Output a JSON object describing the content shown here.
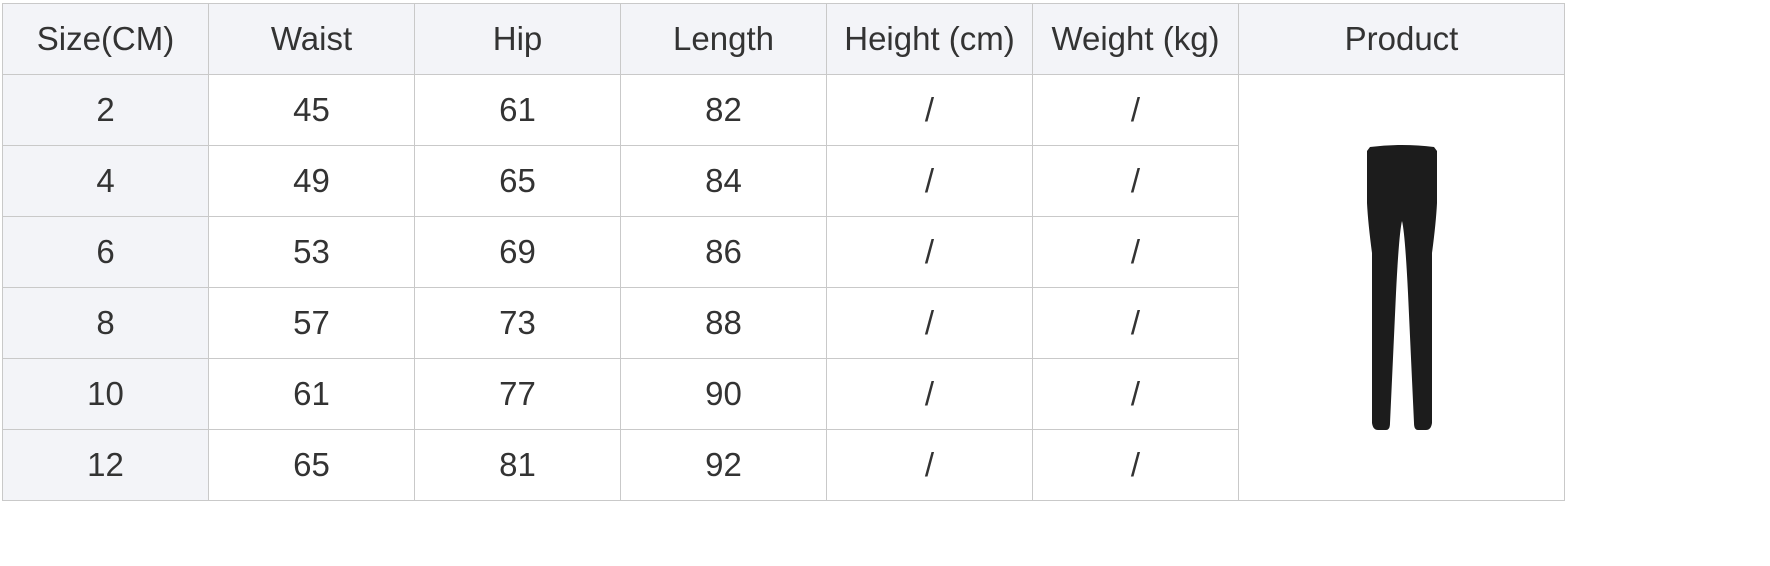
{
  "headers": [
    "Size(CM)",
    "Waist",
    "Hip",
    "Length",
    "Height (cm)",
    "Weight (kg)",
    "Product"
  ],
  "rows": [
    {
      "size": "2",
      "waist": "45",
      "hip": "61",
      "length": "82",
      "height": "/",
      "weight": "/"
    },
    {
      "size": "4",
      "waist": "49",
      "hip": "65",
      "length": "84",
      "height": "/",
      "weight": "/"
    },
    {
      "size": "6",
      "waist": "53",
      "hip": "69",
      "length": "86",
      "height": "/",
      "weight": "/"
    },
    {
      "size": "8",
      "waist": "57",
      "hip": "73",
      "length": "88",
      "height": "/",
      "weight": "/"
    },
    {
      "size": "10",
      "waist": "61",
      "hip": "77",
      "length": "90",
      "height": "/",
      "weight": "/"
    },
    {
      "size": "12",
      "waist": "65",
      "hip": "81",
      "length": "92",
      "height": "/",
      "weight": "/"
    }
  ],
  "product": {
    "icon": "leggings-icon",
    "color": "#1c1c1c"
  },
  "colors": {
    "header_bg": "#f3f4f8",
    "border": "#c9c9c9",
    "text": "#333333"
  }
}
